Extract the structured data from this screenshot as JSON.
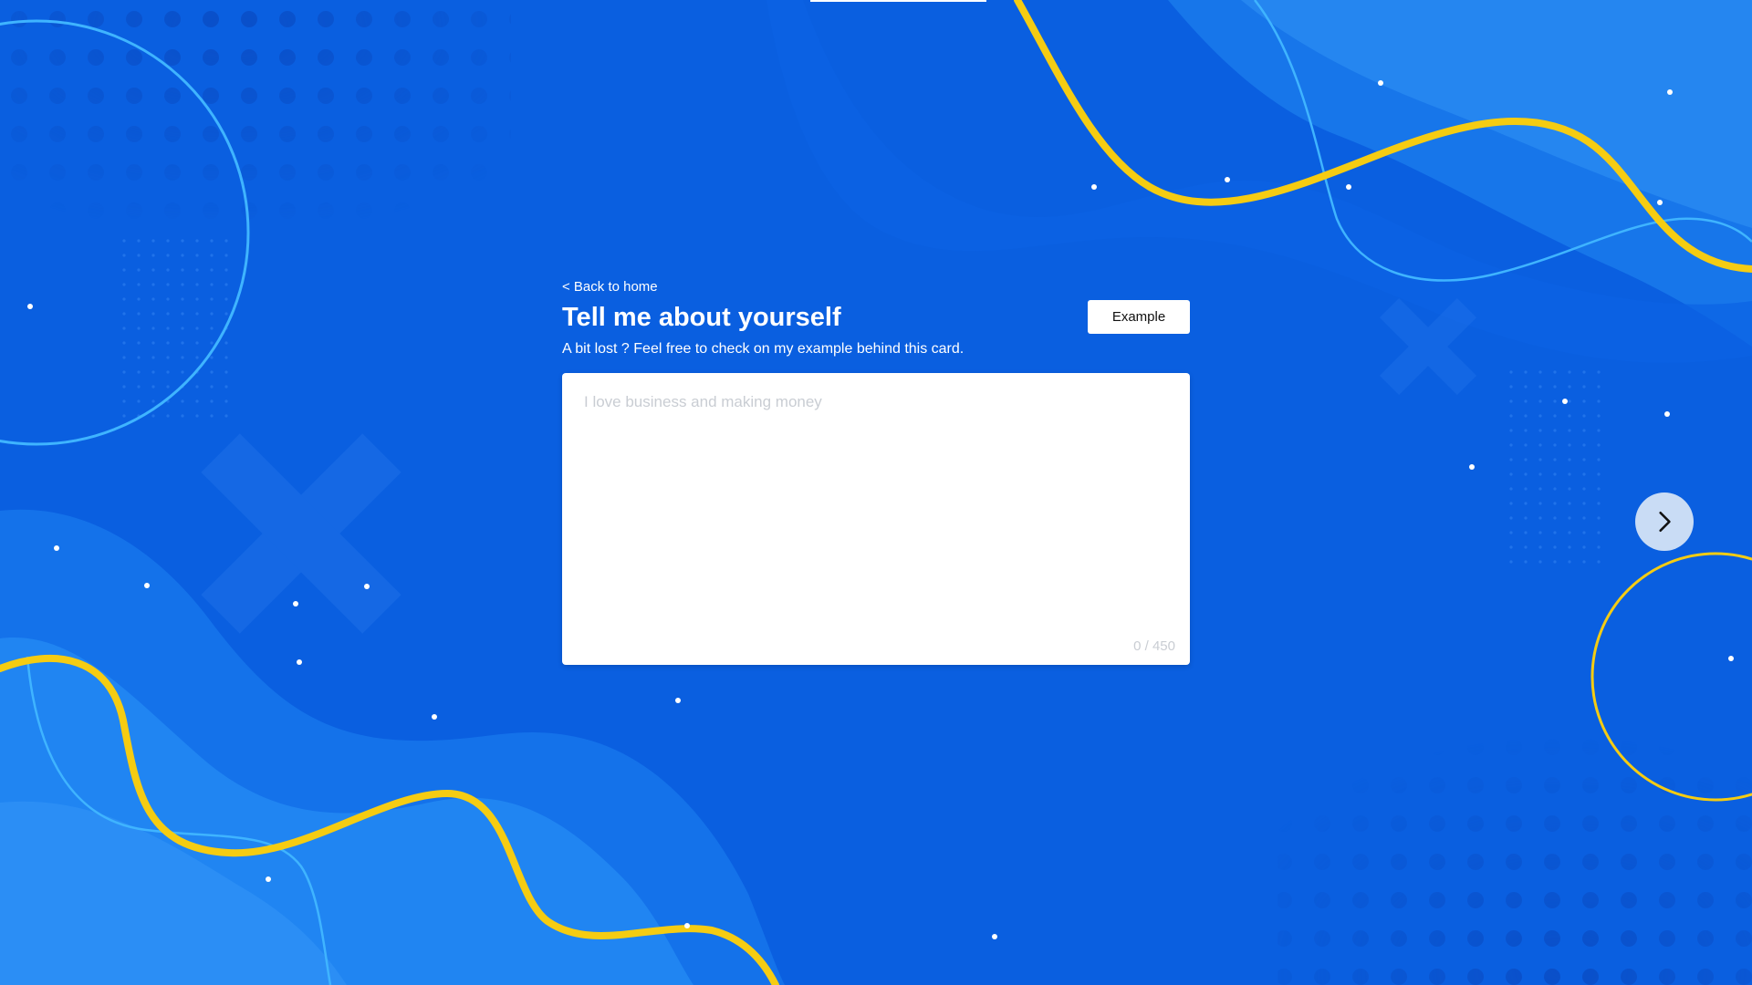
{
  "nav": {
    "back_label": "< Back to home"
  },
  "header": {
    "title": "Tell me about yourself",
    "subtitle": "A bit lost ? Feel free to check on my example behind this card.",
    "example_label": "Example"
  },
  "answer": {
    "placeholder": "I love business and making money",
    "value": "",
    "count": "0 / 450"
  },
  "icons": {
    "next": "chevron-right-icon"
  },
  "colors": {
    "background": "#0a5fe0",
    "accent_wave": "#f5cc12",
    "light_line": "#3fb4ff",
    "card": "#ffffff",
    "next_button": "#c9dcf5"
  }
}
